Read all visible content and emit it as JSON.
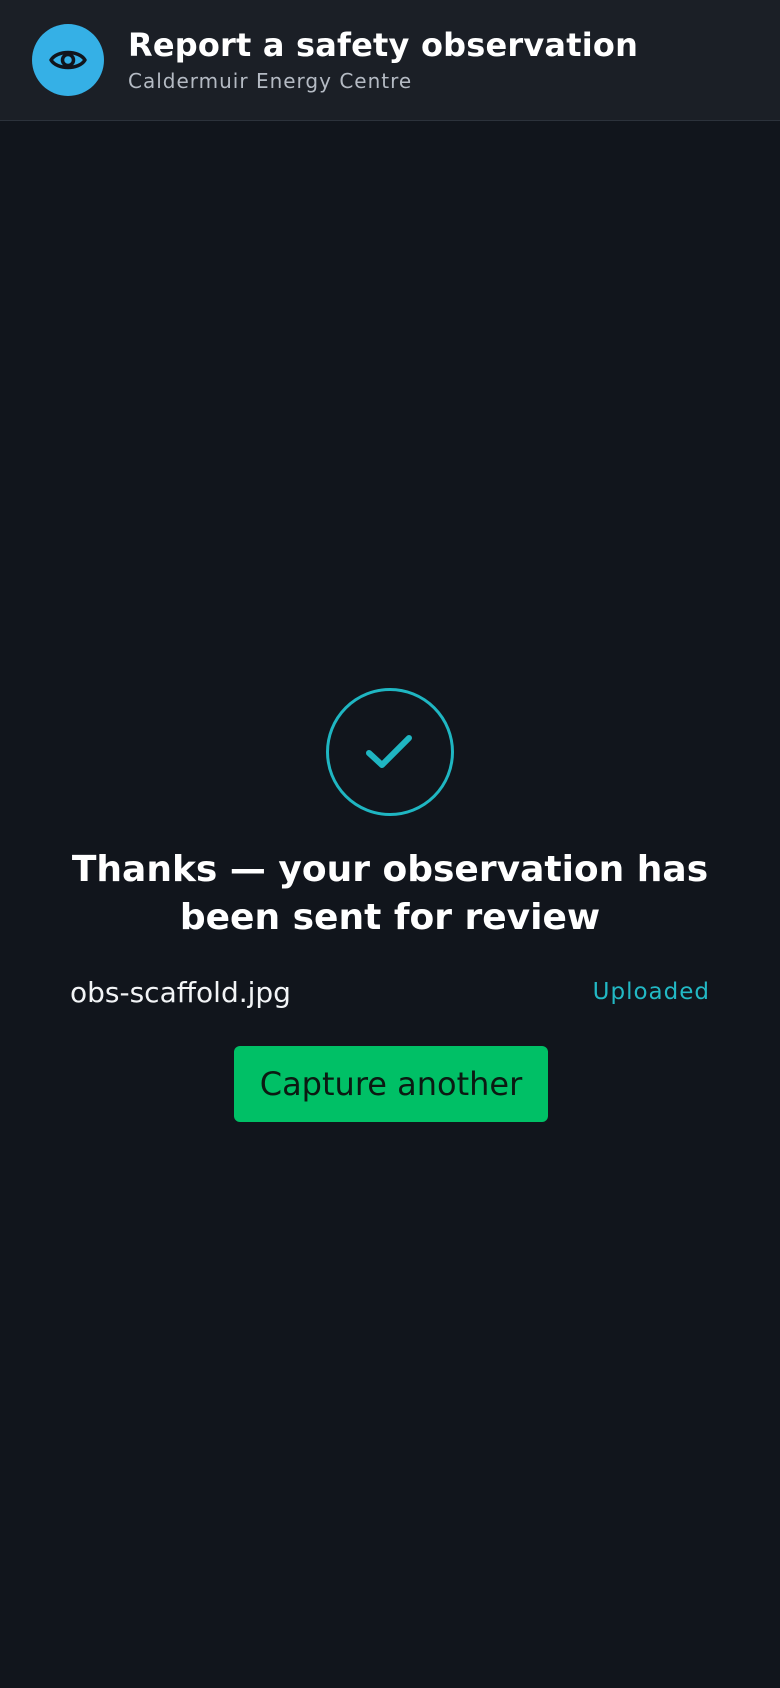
{
  "header": {
    "icon": "eye-icon",
    "title": "Report a safety observation",
    "subtitle": "Caldermuir Energy Centre"
  },
  "confirmation": {
    "icon": "check-circle-icon",
    "message": "Thanks — your observation has been sent for review",
    "file_name": "obs-scaffold.jpg",
    "file_status": "Uploaded",
    "button_label": "Capture another"
  },
  "colors": {
    "background": "#11151c",
    "header_background": "#1b1f26",
    "accent_blue": "#35b0e6",
    "accent_teal": "#1fb6c2",
    "button_green": "#00c066"
  }
}
